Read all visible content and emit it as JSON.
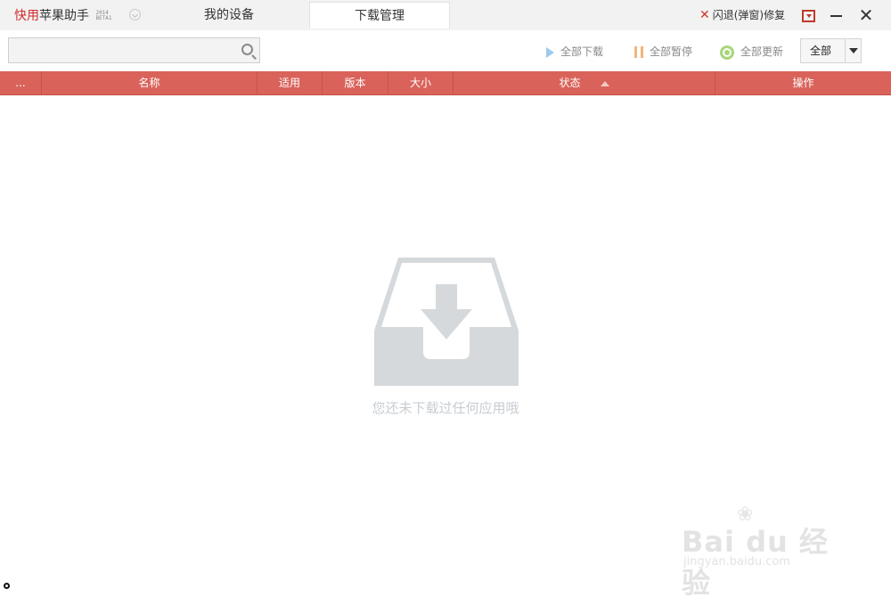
{
  "titlebar": {
    "brand": "快用",
    "app_name": "苹果助手",
    "version_top": "2014",
    "version_bottom": "BETA1",
    "tabs": [
      {
        "label": "我的设备"
      },
      {
        "label": "下载管理"
      }
    ],
    "repair_label": "闪退(弹窗)修复"
  },
  "toolbar": {
    "search_value": "",
    "download_all": "全部下载",
    "pause_all": "全部暂停",
    "update_all": "全部更新",
    "filter_selected": "全部"
  },
  "table": {
    "columns": [
      "...",
      "名称",
      "适用",
      "版本",
      "大小",
      "状态",
      "操作"
    ]
  },
  "empty": {
    "message": "您还未下载过任何应用哦"
  },
  "watermark": {
    "logo": "Bai du 经验",
    "url": "jingyan.baidu.com"
  },
  "colors": {
    "accent": "#d9635a",
    "brand_red": "#d02b2b",
    "empty_icon": "#d5d9dc",
    "empty_text": "#c8cdd2"
  },
  "icons": {
    "search": "magnifier-icon",
    "download": "play-triangle-icon",
    "pause": "pause-icon",
    "update": "refresh-circle-icon",
    "repair": "tools-icon",
    "empty": "download-tray-icon"
  }
}
